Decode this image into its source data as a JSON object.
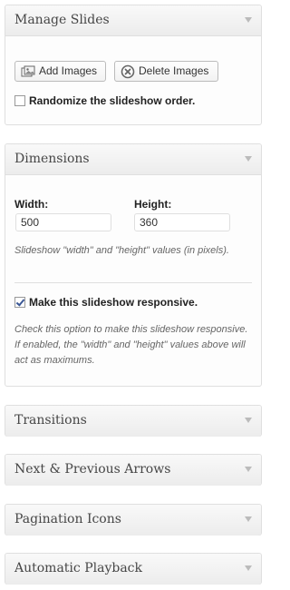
{
  "manage_slides": {
    "title": "Manage Slides",
    "add_images_label": "Add Images",
    "delete_images_label": "Delete Images",
    "randomize_label": "Randomize the slideshow order.",
    "randomize_checked": false
  },
  "dimensions": {
    "title": "Dimensions",
    "width_label": "Width:",
    "width_value": "500",
    "height_label": "Height:",
    "height_value": "360",
    "size_description": "Slideshow \"width\" and \"height\" values (in pixels).",
    "responsive_label": "Make this slideshow responsive.",
    "responsive_checked": true,
    "responsive_description": "Check this option to make this slideshow responsive. If enabled, the \"width\" and \"height\" values above will act as maximums."
  },
  "collapsed_sections": [
    {
      "title": "Transitions"
    },
    {
      "title": "Next & Previous Arrows"
    },
    {
      "title": "Pagination Icons"
    },
    {
      "title": "Automatic Playback"
    }
  ],
  "icons": {
    "add_images": "images-icon",
    "delete_images": "circle-x-icon",
    "toggle": "triangle-down-icon"
  },
  "colors": {
    "header_text": "#464646",
    "toggle_arrow": "#bbbbbb",
    "checkmark": "#3a5795"
  }
}
